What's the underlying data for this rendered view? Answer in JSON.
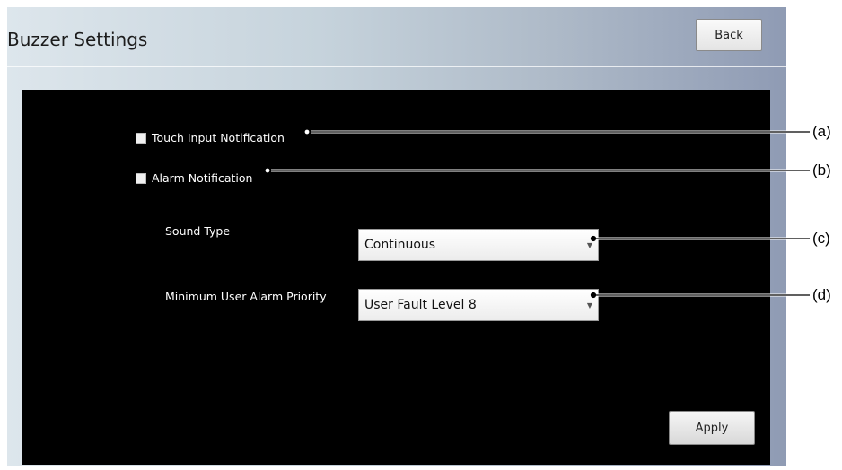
{
  "header": {
    "title": "Buzzer Settings",
    "back_label": "Back"
  },
  "options": {
    "touch_input": {
      "label": "Touch Input Notification",
      "checked": false
    },
    "alarm": {
      "label": "Alarm Notification",
      "checked": false
    }
  },
  "fields": {
    "sound_type": {
      "label": "Sound Type",
      "value": "Continuous"
    },
    "min_priority": {
      "label": "Minimum User Alarm Priority",
      "value": "User Fault Level 8"
    }
  },
  "footer": {
    "apply_label": "Apply"
  },
  "callouts": [
    "(a)",
    "(b)",
    "(c)",
    "(d)"
  ],
  "colors": {
    "panel": "#000000",
    "text": "#ffffff",
    "line": "#000000"
  },
  "icons": {
    "dropdown": "chevron-down-icon",
    "checkbox": "checkbox-icon"
  }
}
